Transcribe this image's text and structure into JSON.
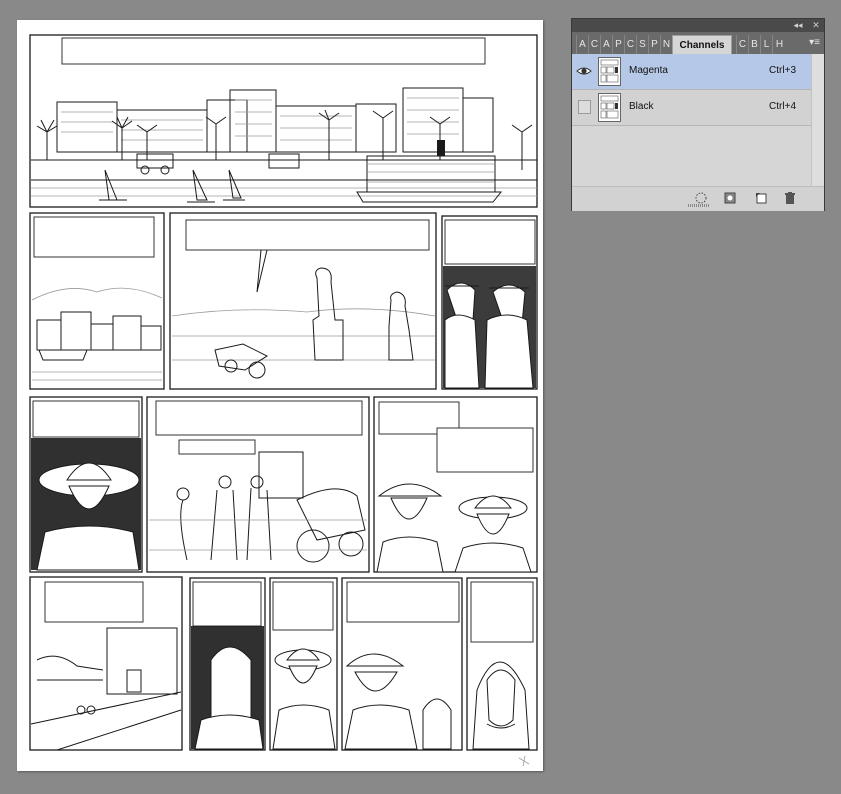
{
  "panel_tabs": [
    "A",
    "C",
    "A",
    "P",
    "C",
    "S",
    "P",
    "N",
    "Channels",
    "C",
    "B",
    "L",
    "H"
  ],
  "window_controls": {
    "collapse": "◂◂",
    "close": "✕"
  },
  "channels": [
    {
      "name": "Magenta",
      "shortcut": "Ctrl+3",
      "visible": true,
      "selected": true
    },
    {
      "name": "Black",
      "shortcut": "Ctrl+4",
      "visible": false,
      "selected": false
    }
  ],
  "bottom_icons": [
    "load-selection-icon",
    "save-selection-icon",
    "new-channel-icon",
    "trash-icon"
  ],
  "colors": {
    "workspace": "#898989",
    "panel_bg": "#d6d6d6",
    "selected_row": "#b5c8e8"
  }
}
